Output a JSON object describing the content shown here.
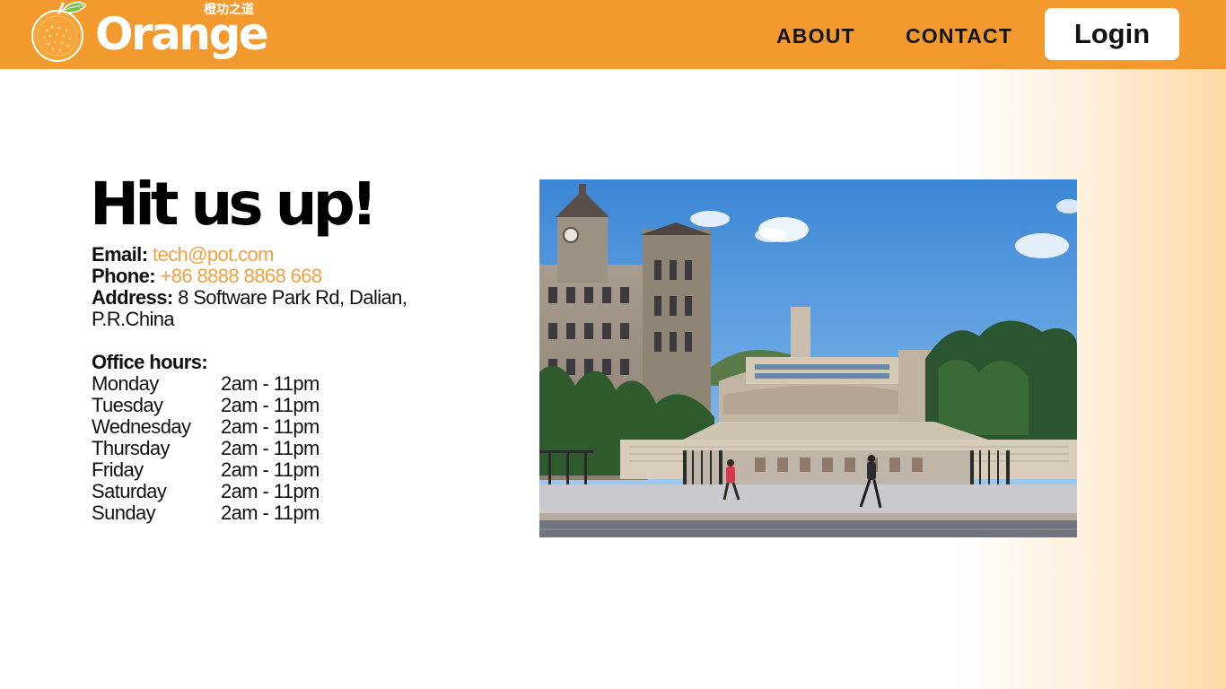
{
  "logo": {
    "wordmark": "Orange",
    "subtitle": "橙功之道",
    "icon": "orange-fruit-icon"
  },
  "nav": {
    "about": "ABOUT",
    "contact": "CONTACT",
    "login": "Login"
  },
  "contact": {
    "headline": "Hit us up!",
    "email_label": "Email:",
    "email": "tech@pot.com",
    "phone_label": "Phone:",
    "phone": "+86 8888 8868 668",
    "address_label": "Address:",
    "address": "8 Software Park Rd, Dalian,",
    "address_line2": "P.R.China",
    "hours_title": "Office hours:",
    "hours": [
      {
        "day": "Monday",
        "time": "2am - 11pm"
      },
      {
        "day": "Tuesday",
        "time": "2am - 11pm"
      },
      {
        "day": "Wednesday",
        "time": "2am - 11pm"
      },
      {
        "day": "Thursday",
        "time": "2am - 11pm"
      },
      {
        "day": "Friday",
        "time": "2am - 11pm"
      },
      {
        "day": "Saturday",
        "time": "2am - 11pm"
      },
      {
        "day": "Sunday",
        "time": "2am - 11pm"
      }
    ]
  },
  "colors": {
    "brand": "#f29a2e",
    "link": "#f2a040",
    "text": "#111111"
  }
}
